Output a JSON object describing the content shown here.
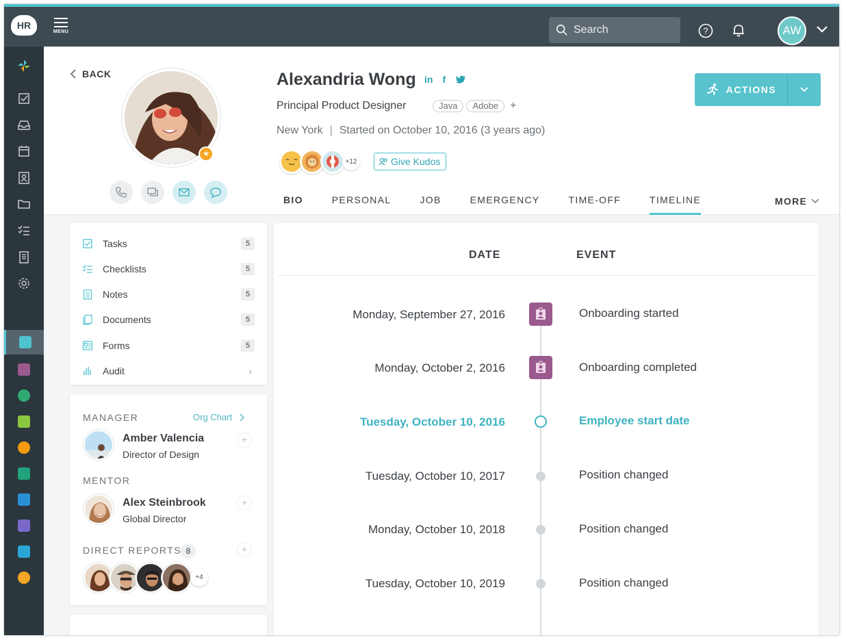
{
  "app": {
    "logo_text": "HR",
    "menu_label": "MENU"
  },
  "search": {
    "placeholder": "Search"
  },
  "user": {
    "initials": "AW"
  },
  "profile": {
    "back_label": "BACK",
    "name": "Alexandria Wong",
    "socials": [
      "in",
      "f"
    ],
    "title": "Principal Product Designer",
    "skills": [
      "Java",
      "Adobe"
    ],
    "skill_add": "+",
    "location": "New York",
    "separator": "|",
    "started": "Started on October 10, 2016 (3 years ago)",
    "kudos_more": "+12",
    "give_kudos_label": "Give Kudos"
  },
  "actions": {
    "label": "ACTIONS"
  },
  "tabs": [
    {
      "label": "BIO"
    },
    {
      "label": "PERSONAL"
    },
    {
      "label": "JOB"
    },
    {
      "label": "EMERGENCY"
    },
    {
      "label": "TIME-OFF"
    },
    {
      "label": "TIMELINE"
    }
  ],
  "more_label": "MORE",
  "lists": [
    {
      "label": "Tasks",
      "count": "5",
      "icon": "check-square-icon"
    },
    {
      "label": "Checklists",
      "count": "5",
      "icon": "checklist-icon"
    },
    {
      "label": "Notes",
      "count": "5",
      "icon": "notes-icon"
    },
    {
      "label": "Documents",
      "count": "5",
      "icon": "documents-icon"
    },
    {
      "label": "Forms",
      "count": "5",
      "icon": "forms-icon"
    },
    {
      "label": "Audit",
      "count": "",
      "icon": "audit-icon"
    }
  ],
  "people": {
    "manager_label": "MANAGER",
    "org_chart_label": "Org Chart",
    "manager": {
      "name": "Amber Valencia",
      "role": "Director of Design"
    },
    "mentor_label": "MENTOR",
    "mentor": {
      "name": "Alex Steinbrook",
      "role": "Global Director"
    },
    "direct_reports_label": "DIRECT REPORTS",
    "direct_reports_count": "8",
    "reports_more": "+4"
  },
  "timeline": {
    "date_header": "DATE",
    "event_header": "EVENT",
    "entries": [
      {
        "date": "Monday, September 27, 2016",
        "event": "Onboarding started",
        "marker": "badge"
      },
      {
        "date": "Monday, October 2, 2016",
        "event": "Onboarding completed",
        "marker": "badge"
      },
      {
        "date": "Tuesday, October 10, 2016",
        "event": "Employee start date",
        "marker": "ring"
      },
      {
        "date": "Tuesday, October 10, 2017",
        "event": "Position changed",
        "marker": "dot"
      },
      {
        "date": "Monday, October 10, 2018",
        "event": "Position changed",
        "marker": "dot"
      },
      {
        "date": "Tuesday, October 10, 2019",
        "event": "Position changed",
        "marker": "dot"
      }
    ]
  },
  "colors": {
    "accent": "#4fc3cf",
    "topbar": "#3e4a52",
    "sidebar": "#2c363d",
    "onboarding_badge": "#9a5a8e",
    "highlight_text": "#3fb3c1"
  }
}
